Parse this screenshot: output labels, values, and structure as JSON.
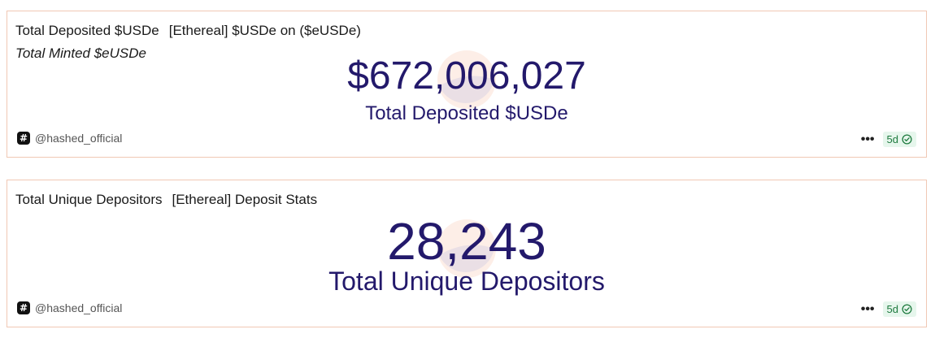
{
  "cards": [
    {
      "title": "Total Deposited $USDe",
      "query": "[Ethereal] $USDe on ($eUSDe)",
      "subtitle": "Total Minted $eUSDe",
      "value": "$672,006,027",
      "value_label": "Total Deposited $USDe",
      "author": "@hashed_official",
      "age": "5d",
      "colors": {
        "value": "#23196b",
        "border": "#f0c8b4",
        "badge_bg": "#e6f6ec",
        "badge_text": "#1e7a3e"
      }
    },
    {
      "title": "Total Unique Depositors",
      "query": "[Ethereal] Deposit Stats",
      "value": "28,243",
      "value_label": "Total Unique Depositors",
      "author": "@hashed_official",
      "age": "5d",
      "colors": {
        "value": "#23196b",
        "border": "#f0c8b4",
        "badge_bg": "#e6f6ec",
        "badge_text": "#1e7a3e"
      }
    }
  ],
  "icons": {
    "author": "hashtag-icon",
    "more": "more-dots-icon",
    "verified": "check-circle-icon"
  }
}
